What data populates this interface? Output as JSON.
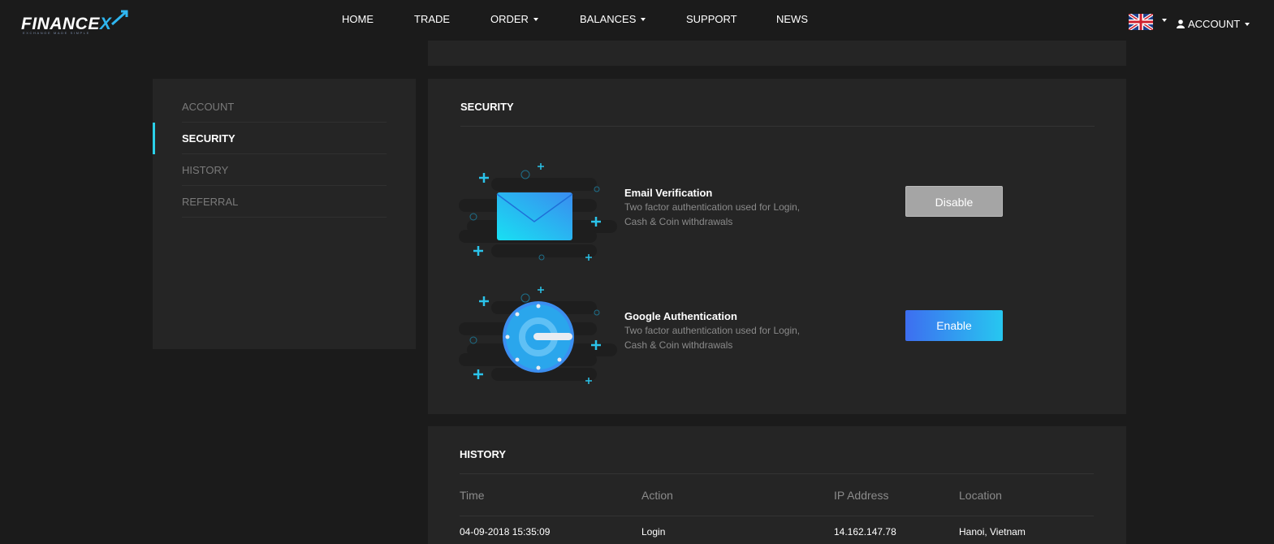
{
  "brand": {
    "name_main": "FINANCE",
    "name_x": "X",
    "tagline": "EXCHANGE MADE SIMPLE"
  },
  "nav": {
    "home": "HOME",
    "trade": "TRADE",
    "order": "ORDER",
    "balances": "BALANCES",
    "support": "SUPPORT",
    "news": "NEWS",
    "account": "ACCOUNT",
    "language_flag": "uk-flag-icon"
  },
  "sidebar": {
    "items": [
      {
        "label": "ACCOUNT",
        "active": false
      },
      {
        "label": "SECURITY",
        "active": true
      },
      {
        "label": "HISTORY",
        "active": false
      },
      {
        "label": "REFERRAL",
        "active": false
      }
    ]
  },
  "security": {
    "title": "SECURITY",
    "features": [
      {
        "title": "Email Verification",
        "desc_line1": "Two factor authentication used for Login,",
        "desc_line2": "Cash & Coin withdrawals",
        "button": "Disable",
        "icon": "envelope-icon"
      },
      {
        "title": "Google Authentication",
        "desc_line1": "Two factor authentication used for Login,",
        "desc_line2": "Cash & Coin withdrawals",
        "button": "Enable",
        "icon": "authenticator-icon"
      }
    ]
  },
  "history": {
    "title": "HISTORY",
    "columns": [
      "Time",
      "Action",
      "IP Address",
      "Location"
    ],
    "rows": [
      [
        "04-09-2018 15:35:09",
        "Login",
        "14.162.147.78",
        "Hanoi, Vietnam"
      ]
    ]
  },
  "colors": {
    "background": "#1b1b1b",
    "panel": "#252525",
    "accent": "#2bd0e8",
    "enable_start": "#3d6ef0",
    "enable_end": "#27c7f0",
    "disable": "#a5a5a5"
  }
}
